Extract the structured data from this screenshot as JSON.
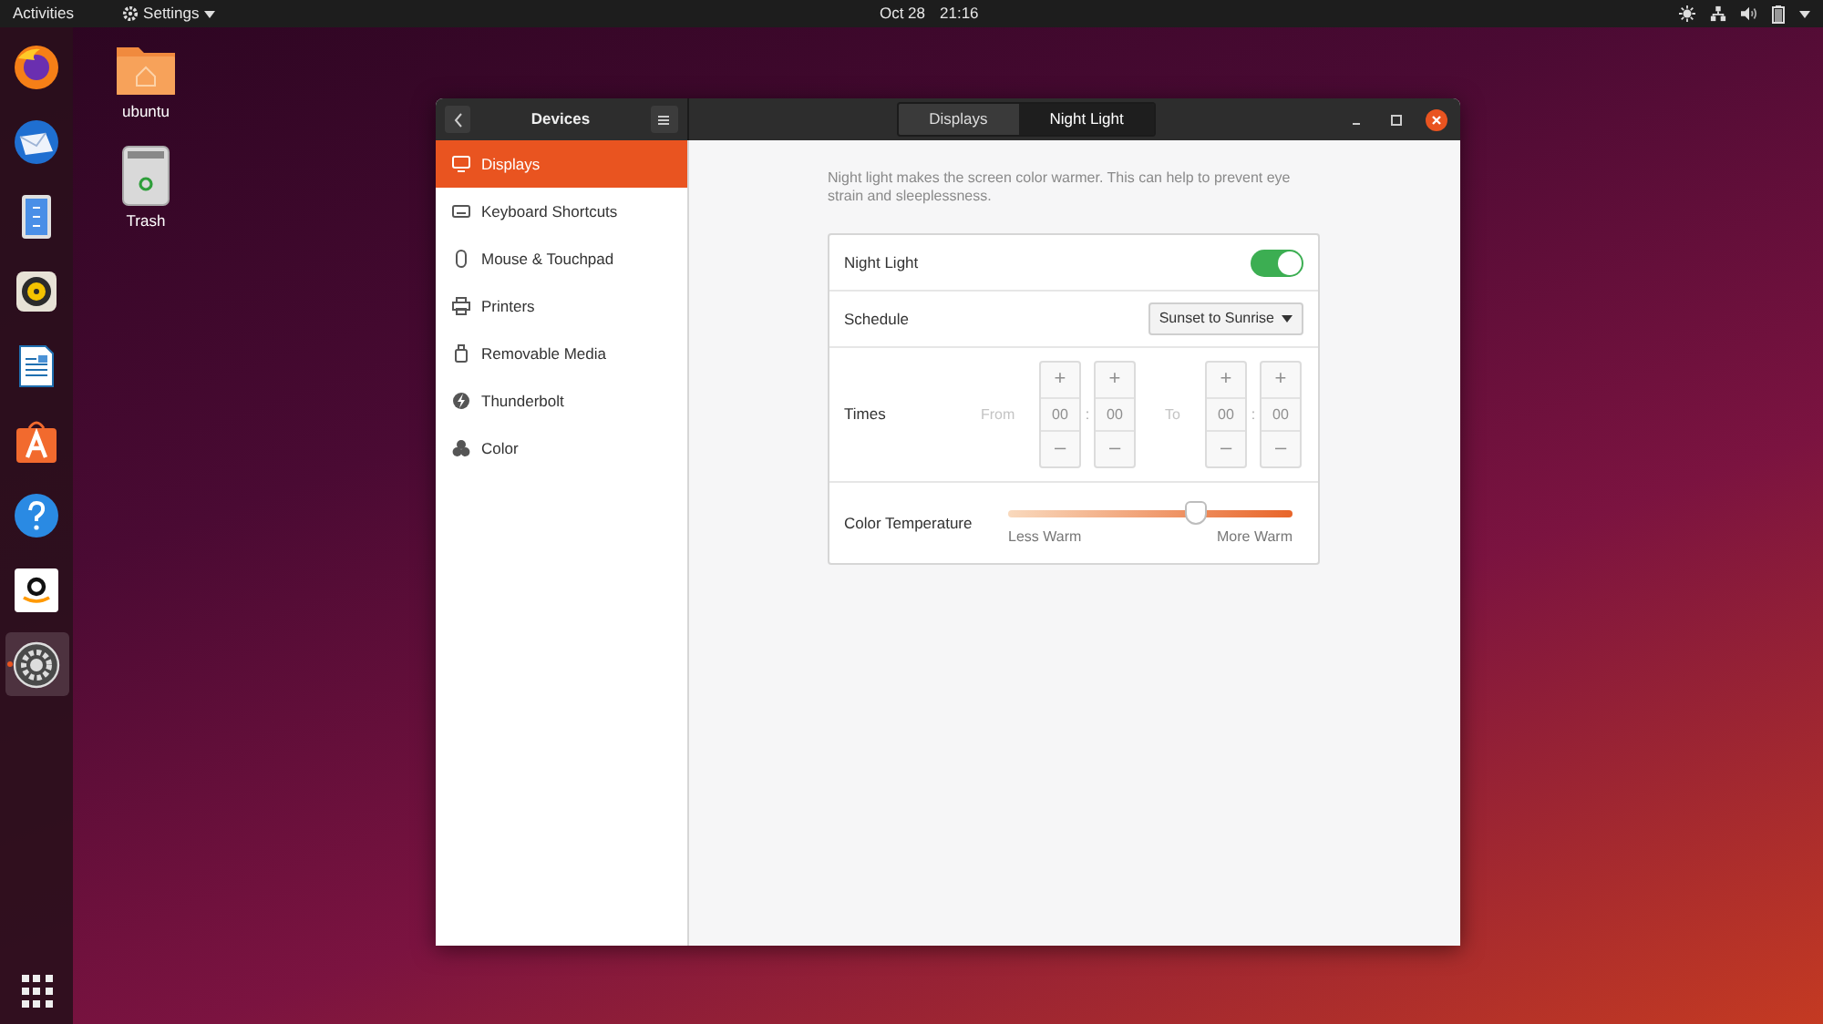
{
  "top_bar": {
    "activities": "Activities",
    "app_menu": "Settings",
    "date": "Oct 28",
    "time": "21:16"
  },
  "dock": [
    {
      "kind": "browser",
      "selected": false
    },
    {
      "kind": "mail",
      "selected": false
    },
    {
      "kind": "files",
      "selected": false
    },
    {
      "kind": "music",
      "selected": false
    },
    {
      "kind": "writer",
      "selected": false
    },
    {
      "kind": "store",
      "selected": false
    },
    {
      "kind": "help",
      "selected": false
    },
    {
      "kind": "shop",
      "selected": false
    },
    {
      "kind": "settings",
      "selected": true
    }
  ],
  "desktop_icons": [
    {
      "kind": "home",
      "label": "ubuntu"
    },
    {
      "kind": "trash",
      "label": "Trash"
    }
  ],
  "window": {
    "sidebar_title": "Devices",
    "tabs": [
      {
        "label": "Displays",
        "selected": false
      },
      {
        "label": "Night Light",
        "selected": true
      }
    ],
    "sidebar": [
      {
        "kind": "display",
        "label": "Displays",
        "selected": true
      },
      {
        "kind": "keyboard",
        "label": "Keyboard Shortcuts",
        "selected": false
      },
      {
        "kind": "mouse",
        "label": "Mouse & Touchpad",
        "selected": false
      },
      {
        "kind": "printer",
        "label": "Printers",
        "selected": false
      },
      {
        "kind": "media",
        "label": "Removable Media",
        "selected": false
      },
      {
        "kind": "thunderbolt",
        "label": "Thunderbolt",
        "selected": false
      },
      {
        "kind": "color",
        "label": "Color",
        "selected": false
      }
    ],
    "description": "Night light makes the screen color warmer. This can help to prevent eye strain and sleeplessness.",
    "night_light": {
      "label": "Night Light",
      "on": true
    },
    "schedule": {
      "label": "Schedule",
      "value": "Sunset to Sunrise"
    },
    "times": {
      "label": "Times",
      "disabled": true,
      "from_label": "From",
      "to_label": "To",
      "separator": ":",
      "plus": "+",
      "minus": "–",
      "fields": [
        {
          "value": "00"
        },
        {
          "value": "00"
        },
        {
          "value": "00"
        },
        {
          "value": "00"
        }
      ]
    },
    "color_temperature": {
      "label": "Color Temperature",
      "level": 0.66,
      "min_label": "Less Warm",
      "max_label": "More Warm"
    }
  }
}
